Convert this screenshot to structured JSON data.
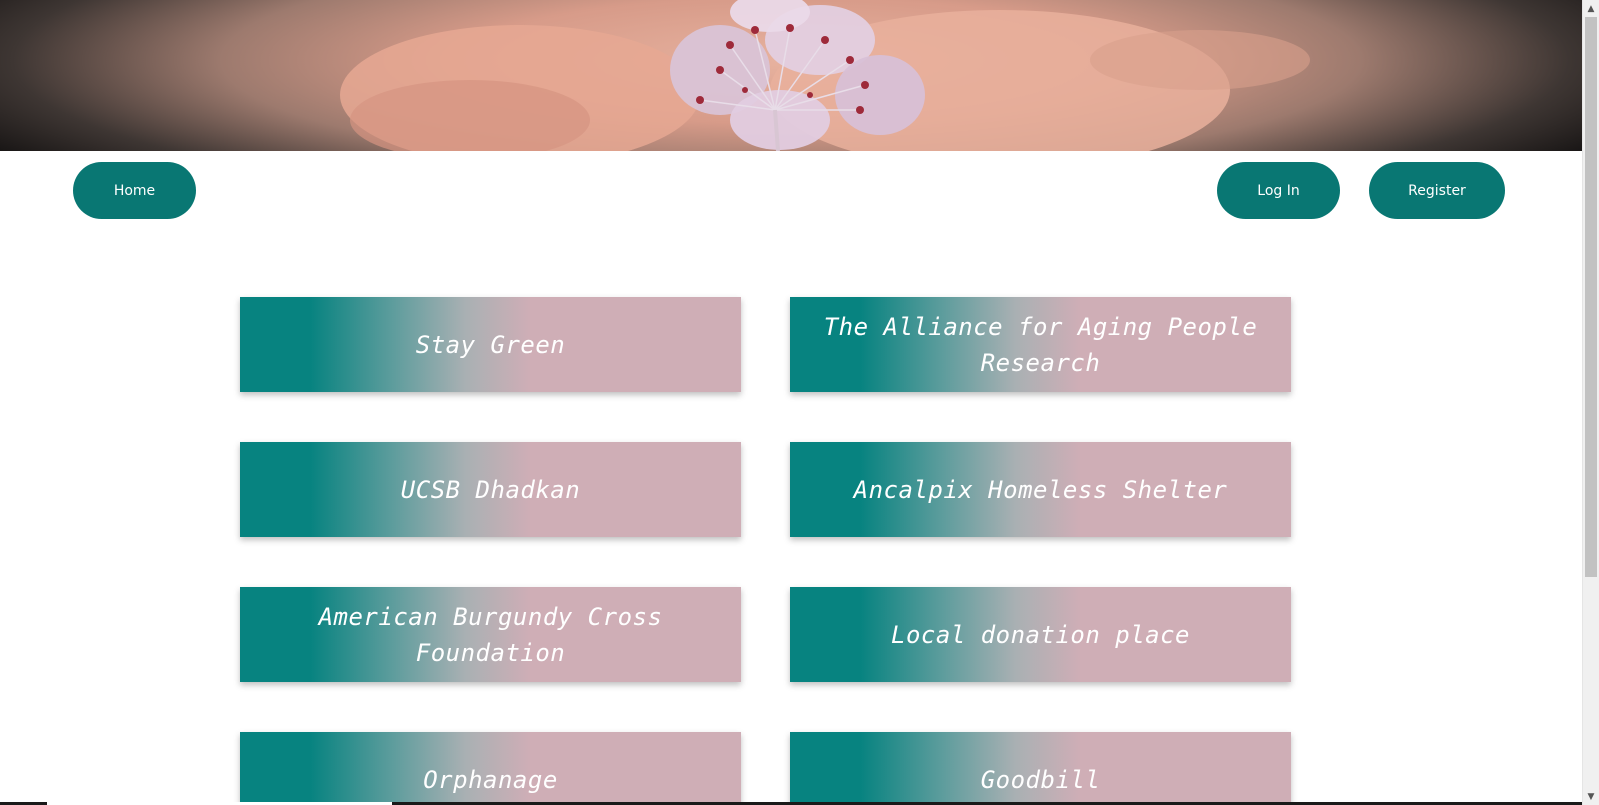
{
  "hero": {
    "image": "flower-in-hands-banner"
  },
  "nav": {
    "home_label": "Home",
    "login_label": "Log In",
    "register_label": "Register"
  },
  "organizations": [
    {
      "name": "Stay Green"
    },
    {
      "name": "The Alliance for Aging People Research"
    },
    {
      "name": "UCSB Dhadkan"
    },
    {
      "name": "Ancalpix Homeless Shelter"
    },
    {
      "name": "American Burgundy Cross Foundation"
    },
    {
      "name": "Local donation place"
    },
    {
      "name": "Orphanage"
    },
    {
      "name": "Goodbill"
    }
  ],
  "colors": {
    "accent": "#097773",
    "card_teal": "#078380",
    "card_pink": "#cfaeb6"
  },
  "scrollbar": {
    "up_icon": "chevron-up-icon",
    "down_icon": "chevron-down-icon"
  }
}
